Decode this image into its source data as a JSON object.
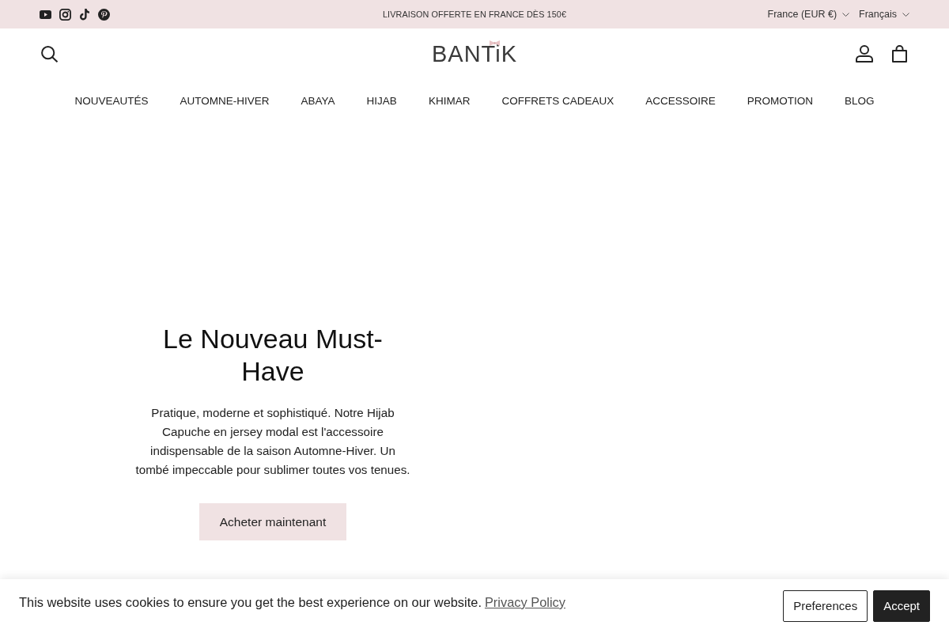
{
  "announcement_bar": {
    "message": "LIVRAISON OFFERTE EN FRANCE DÈS 150€",
    "selectors": [
      {
        "label": "France (EUR €)"
      },
      {
        "label": "Français"
      }
    ]
  },
  "header": {
    "logo": "BANTiK"
  },
  "nav": {
    "items": [
      "NOUVEAUTÉS",
      "AUTOMNE-HIVER",
      "ABAYA",
      "HIJAB",
      "KHIMAR",
      "COFFRETS CADEAUX",
      "ACCESSOIRE",
      "PROMOTION",
      "BLOG"
    ]
  },
  "hero": {
    "title": "Le Nouveau Must-Have",
    "text": "Pratique, moderne et sophistiqué. Notre Hijab Capuche en jersey modal est l'accessoire indispensable de la saison Automne-Hiver. Un tombé impeccable pour sublimer toutes vos tenues.",
    "button": "Acheter maintenant"
  },
  "cookie_banner": {
    "text": "This website uses cookies to ensure you get the best experience on our website.",
    "link": "Privacy Policy",
    "buttons": [
      {
        "label": "Preferences",
        "kind": "outline"
      },
      {
        "label": "Accept",
        "kind": "solid"
      }
    ]
  }
}
